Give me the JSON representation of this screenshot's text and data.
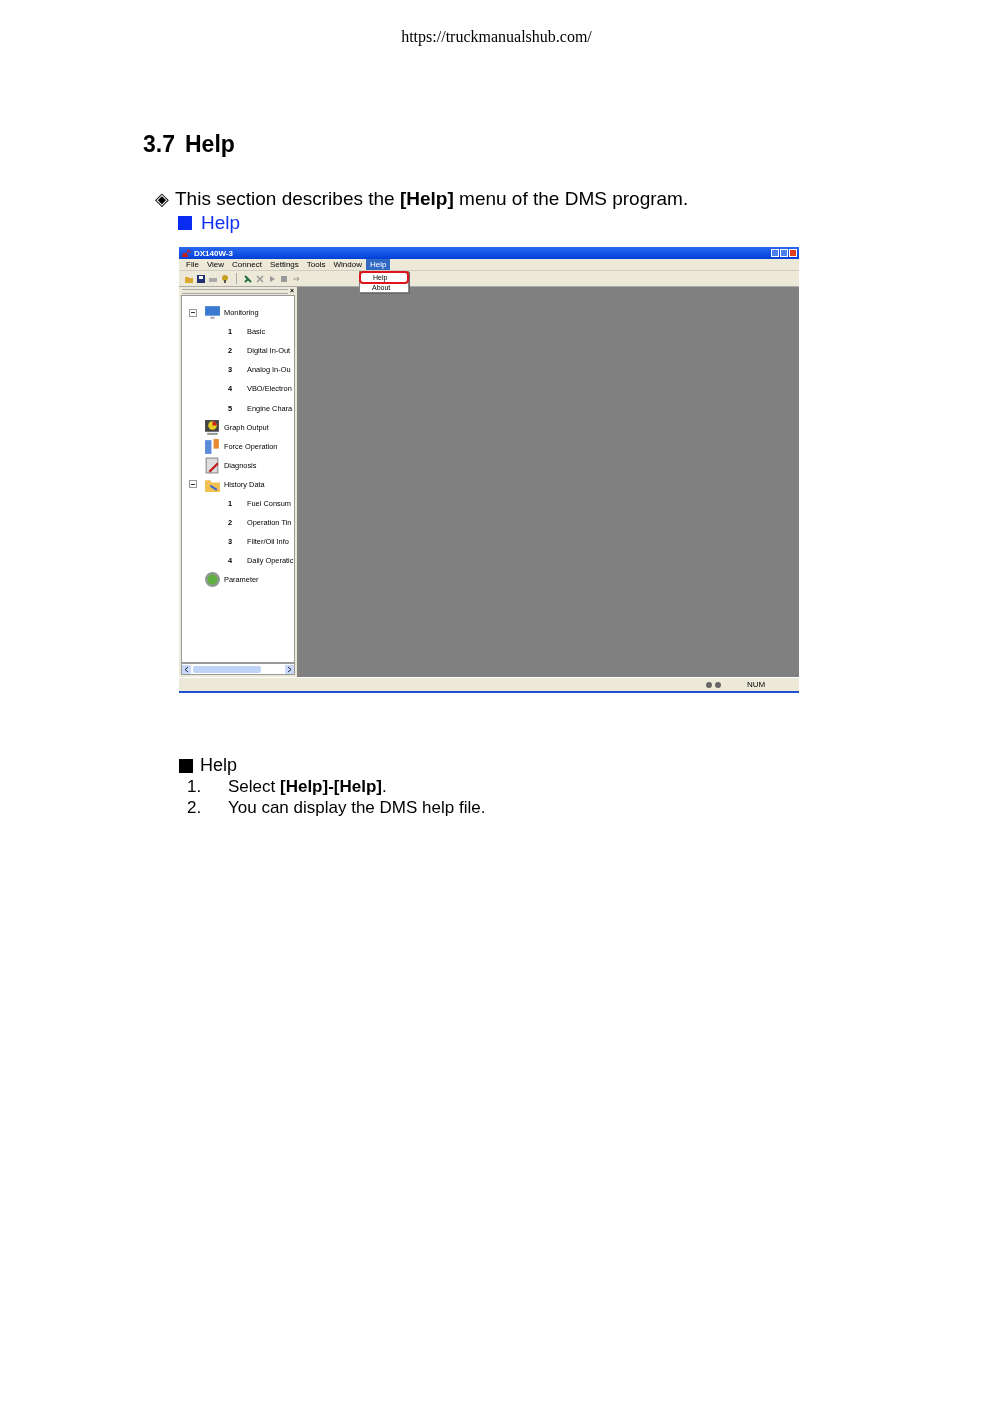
{
  "page_header": "https://truckmanualshub.com/",
  "heading": {
    "number": "3.7",
    "title": "Help"
  },
  "intro": {
    "bullet": "◈",
    "text": "This section describes the **[Help]** menu of the DMS program."
  },
  "section_link": "Help",
  "window": {
    "title": "DX140W-3",
    "menu": [
      {
        "label": "File",
        "selected": false
      },
      {
        "label": "View",
        "selected": false
      },
      {
        "label": "Connect",
        "selected": false
      },
      {
        "label": "Settings",
        "selected": false
      },
      {
        "label": "Tools",
        "selected": false
      },
      {
        "label": "Window",
        "selected": false
      },
      {
        "label": "Help",
        "selected": true
      }
    ],
    "dropdown": [
      {
        "label": "Help",
        "selected": true
      },
      {
        "label": "About",
        "selected": false
      }
    ],
    "panel_close": "×",
    "tree": [
      {
        "label": "Monitoring",
        "expanded": true,
        "children": [
          {
            "number": "1",
            "label": "Basic"
          },
          {
            "number": "2",
            "label": "Digital In-Out"
          },
          {
            "number": "3",
            "label": "Analog In-Ou"
          },
          {
            "number": "4",
            "label": "VBO/Electron"
          },
          {
            "number": "5",
            "label": "Engine Chara"
          }
        ]
      },
      {
        "label": "Graph Output"
      },
      {
        "label": "Force Operation"
      },
      {
        "label": "Diagnosis"
      },
      {
        "label": "History Data",
        "expanded": true,
        "children": [
          {
            "number": "1",
            "label": "Fuel Consum"
          },
          {
            "number": "2",
            "label": "Operation Tin"
          },
          {
            "number": "3",
            "label": "Filter/Oil Info"
          },
          {
            "number": "4",
            "label": "Daily Operatic"
          }
        ]
      },
      {
        "label": "Parameter"
      }
    ],
    "status_bar": {
      "indicator": "NUM"
    }
  },
  "subsection": {
    "title": "Help",
    "steps": [
      {
        "number": "1.",
        "text": "Select **[Help]-[Help]**."
      },
      {
        "number": "2.",
        "text": "You can display the DMS help file."
      }
    ]
  }
}
